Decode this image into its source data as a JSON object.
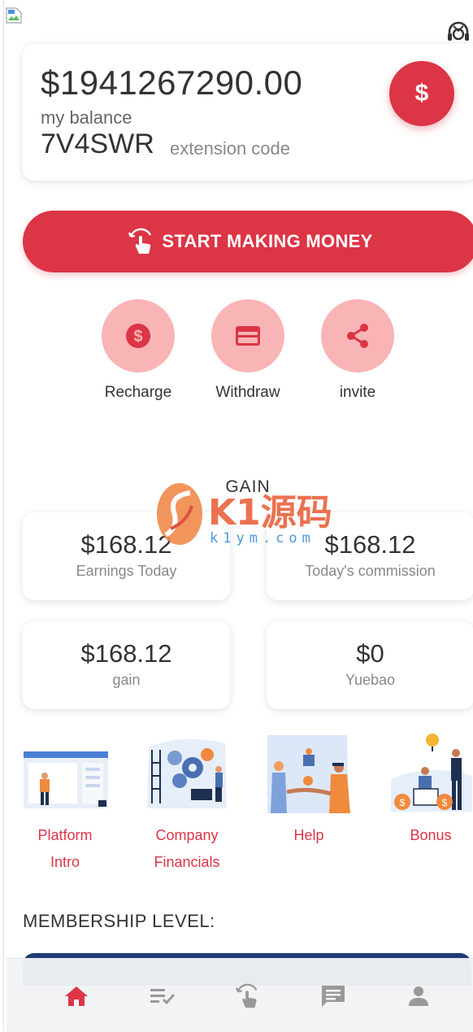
{
  "balance": {
    "amount": "$1941267290.00",
    "label": "my balance",
    "code": "7V4SWR",
    "code_label": "extension code",
    "button_icon": "$"
  },
  "start_button": {
    "label": "START MAKING MONEY",
    "icon": "tap-hand-icon"
  },
  "actions": [
    {
      "label": "Recharge",
      "icon": "dollar-icon"
    },
    {
      "label": "Withdraw",
      "icon": "card-icon"
    },
    {
      "label": "invite",
      "icon": "share-icon"
    }
  ],
  "gain": {
    "title": "GAIN",
    "stats": [
      {
        "value": "$168.12",
        "label": "Earnings Today"
      },
      {
        "value": "$168.12",
        "label": "Today's commission"
      },
      {
        "value": "$168.12",
        "label": "gain"
      },
      {
        "value": "$0",
        "label": "Yuebao"
      }
    ]
  },
  "watermark": {
    "text": "K1源码",
    "sub": "k1ym.com"
  },
  "features": [
    {
      "line1": "Platform",
      "line2": "Intro"
    },
    {
      "line1": "Company",
      "line2": "Financials"
    },
    {
      "line1": "Help",
      "line2": ""
    },
    {
      "line1": "Bonus",
      "line2": ""
    }
  ],
  "membership": {
    "title": "MEMBERSHIP LEVEL:"
  },
  "tabbar": {
    "items": [
      {
        "icon": "home-icon",
        "active": true
      },
      {
        "icon": "task-list-icon",
        "active": false
      },
      {
        "icon": "tap-hand-icon",
        "active": false
      },
      {
        "icon": "message-icon",
        "active": false
      },
      {
        "icon": "profile-icon",
        "active": false
      }
    ]
  },
  "colors": {
    "accent": "#dc3545",
    "accent_light": "#f9b4b6",
    "inactive": "#999999"
  }
}
